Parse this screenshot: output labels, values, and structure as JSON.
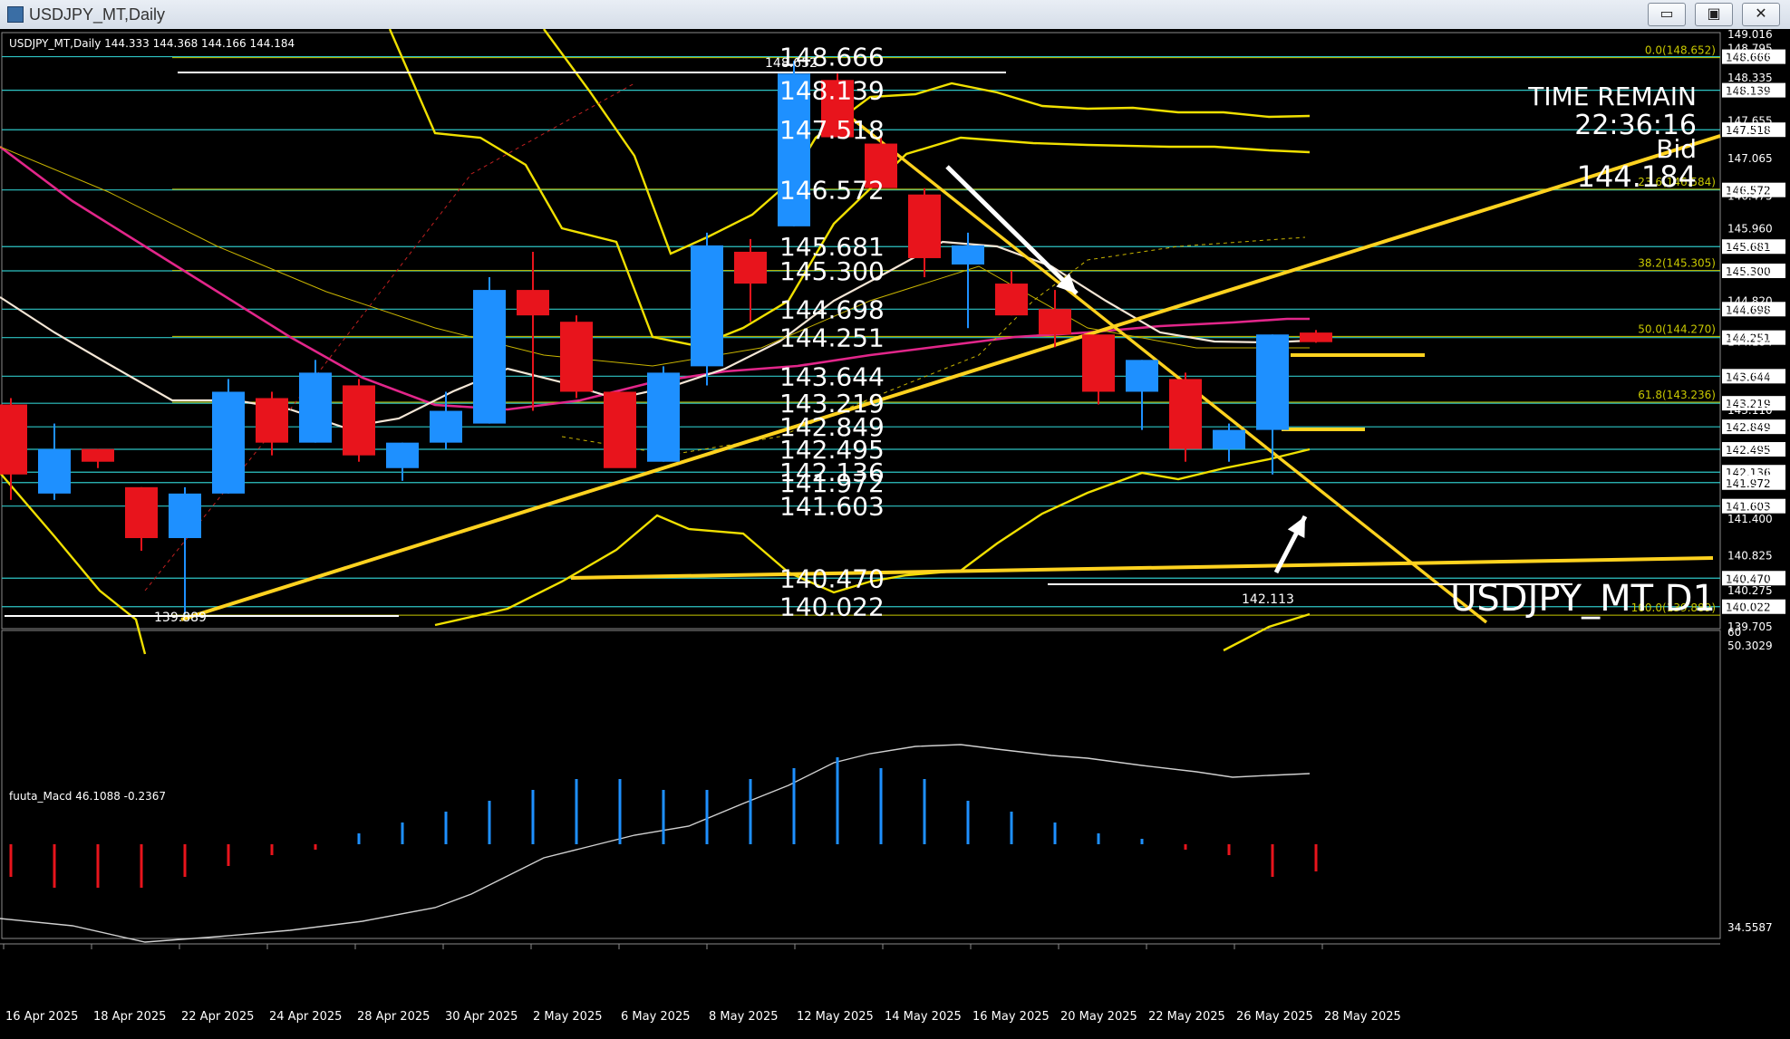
{
  "window": {
    "title": "USDJPY_MT,Daily",
    "minimize_label": "▭",
    "maximize_label": "▣",
    "close_label": "✕"
  },
  "chart": {
    "info": "USDJPY_MT,Daily  144.333 144.368 144.166 144.184",
    "symbol_watermark": "USDJPY_MT D1",
    "time_remain_label": "TIME REMAIN",
    "time_remain_value": "22:36:16",
    "bid_label": "Bid",
    "bid_value": "144.184",
    "low_marker": "139.889",
    "high_marker": "148.652",
    "swing_low_label": "142.113",
    "macd_label": "fuuta_Macd 46.1088  -0.2367"
  },
  "colors": {
    "bull": "#1e90ff",
    "bear": "#e8141c",
    "level_line": "#2ec4c4",
    "fib_line": "#c8c800",
    "trend": "#ffd21f",
    "band": "#f0e000",
    "ma_white": "#f4e6d6",
    "ma_magenta": "#e2268a",
    "grid_text": "#ffffff"
  },
  "chart_data": {
    "type": "candlestick",
    "price_range": [
      139.705,
      149.016
    ],
    "x_dates": [
      "16 Apr 2025",
      "18 Apr 2025",
      "22 Apr 2025",
      "24 Apr 2025",
      "28 Apr 2025",
      "30 Apr 2025",
      "2 May 2025",
      "6 May 2025",
      "8 May 2025",
      "12 May 2025",
      "14 May 2025",
      "16 May 2025",
      "20 May 2025",
      "22 May 2025",
      "26 May 2025",
      "28 May 2025"
    ],
    "price_axis_ticks": [
      "149.016",
      "148.795",
      "148.666",
      "148.335",
      "148.139",
      "147.655",
      "147.518",
      "147.065",
      "146.572",
      "146.475",
      "145.960",
      "145.681",
      "145.300",
      "144.820",
      "144.698",
      "144.251",
      "144.184",
      "143.644",
      "143.219",
      "143.110",
      "142.849",
      "142.495",
      "142.136",
      "141.972",
      "141.603",
      "141.400",
      "140.825",
      "140.470",
      "140.275",
      "140.022",
      "139.705"
    ],
    "macd_axis_ticks": [
      "60",
      "50.3029",
      "34.5587"
    ],
    "candles": [
      {
        "o": 143.2,
        "h": 143.3,
        "l": 141.7,
        "c": 142.1
      },
      {
        "o": 141.8,
        "h": 142.9,
        "l": 141.7,
        "c": 142.5
      },
      {
        "o": 142.5,
        "h": 142.5,
        "l": 142.2,
        "c": 142.3
      },
      {
        "o": 141.9,
        "h": 141.9,
        "l": 140.9,
        "c": 141.1
      },
      {
        "o": 141.1,
        "h": 141.9,
        "l": 139.9,
        "c": 141.8
      },
      {
        "o": 141.8,
        "h": 143.6,
        "l": 141.8,
        "c": 143.4
      },
      {
        "o": 143.3,
        "h": 143.4,
        "l": 142.4,
        "c": 142.6
      },
      {
        "o": 142.6,
        "h": 143.9,
        "l": 142.6,
        "c": 143.7
      },
      {
        "o": 143.5,
        "h": 143.6,
        "l": 142.3,
        "c": 142.4
      },
      {
        "o": 142.2,
        "h": 142.6,
        "l": 142.0,
        "c": 142.6
      },
      {
        "o": 142.6,
        "h": 143.4,
        "l": 142.5,
        "c": 143.1
      },
      {
        "o": 142.9,
        "h": 145.2,
        "l": 142.9,
        "c": 145.0
      },
      {
        "o": 145.0,
        "h": 145.6,
        "l": 143.1,
        "c": 144.6
      },
      {
        "o": 144.5,
        "h": 144.6,
        "l": 143.3,
        "c": 143.4
      },
      {
        "o": 143.4,
        "h": 143.4,
        "l": 142.4,
        "c": 142.2
      },
      {
        "o": 142.3,
        "h": 143.8,
        "l": 142.3,
        "c": 143.7
      },
      {
        "o": 143.8,
        "h": 145.9,
        "l": 143.5,
        "c": 145.7
      },
      {
        "o": 145.6,
        "h": 145.8,
        "l": 144.5,
        "c": 145.1
      },
      {
        "o": 146.0,
        "h": 148.6,
        "l": 146.0,
        "c": 148.4
      },
      {
        "o": 148.3,
        "h": 148.4,
        "l": 147.5,
        "c": 147.4
      },
      {
        "o": 147.3,
        "h": 147.4,
        "l": 146.6,
        "c": 146.6
      },
      {
        "o": 146.5,
        "h": 146.6,
        "l": 145.2,
        "c": 145.5
      },
      {
        "o": 145.4,
        "h": 145.9,
        "l": 144.4,
        "c": 145.7
      },
      {
        "o": 145.1,
        "h": 145.3,
        "l": 144.6,
        "c": 144.6
      },
      {
        "o": 144.7,
        "h": 145.0,
        "l": 144.1,
        "c": 144.3
      },
      {
        "o": 144.3,
        "h": 144.3,
        "l": 143.2,
        "c": 143.4
      },
      {
        "o": 143.4,
        "h": 143.9,
        "l": 142.8,
        "c": 143.9
      },
      {
        "o": 143.6,
        "h": 143.7,
        "l": 142.3,
        "c": 142.5
      },
      {
        "o": 142.5,
        "h": 142.9,
        "l": 142.3,
        "c": 142.8
      },
      {
        "o": 142.8,
        "h": 144.3,
        "l": 142.1,
        "c": 144.3
      },
      {
        "o": 144.33,
        "h": 144.37,
        "l": 144.17,
        "c": 144.18
      }
    ],
    "horizontal_levels": [
      {
        "price": 148.666,
        "label": "148.666"
      },
      {
        "price": 148.139,
        "label": "148.139"
      },
      {
        "price": 147.518,
        "label": "147.518"
      },
      {
        "price": 146.572,
        "label": "146.572"
      },
      {
        "price": 145.681,
        "label": "145.681"
      },
      {
        "price": 145.3,
        "label": "145.300"
      },
      {
        "price": 144.698,
        "label": "144.698"
      },
      {
        "price": 144.251,
        "label": "144.251"
      },
      {
        "price": 143.644,
        "label": "143.644"
      },
      {
        "price": 143.219,
        "label": "143.219"
      },
      {
        "price": 142.849,
        "label": "142.849"
      },
      {
        "price": 142.495,
        "label": "142.495"
      },
      {
        "price": 142.136,
        "label": "142.136"
      },
      {
        "price": 141.972,
        "label": "141.972"
      },
      {
        "price": 141.603,
        "label": "141.603"
      },
      {
        "price": 140.47,
        "label": "140.470"
      },
      {
        "price": 140.022,
        "label": "140.022"
      }
    ],
    "fibonacci": [
      {
        "price": 148.652,
        "label": "0.0(148.652)"
      },
      {
        "price": 146.584,
        "label": "23.6(146.584)"
      },
      {
        "price": 145.305,
        "label": "38.2(145.305)"
      },
      {
        "price": 144.27,
        "label": "50.0(144.270)"
      },
      {
        "price": 143.236,
        "label": "61.8(143.236)"
      },
      {
        "price": 139.889,
        "label": "100.0(139.889)"
      }
    ],
    "macd_histogram": [
      -0.3,
      -0.4,
      -0.4,
      -0.4,
      -0.3,
      -0.2,
      -0.1,
      -0.05,
      0.1,
      0.2,
      0.3,
      0.4,
      0.5,
      0.6,
      0.6,
      0.5,
      0.5,
      0.6,
      0.7,
      0.8,
      0.7,
      0.6,
      0.4,
      0.3,
      0.2,
      0.1,
      0.05,
      -0.05,
      -0.1,
      -0.3,
      -0.25
    ]
  }
}
